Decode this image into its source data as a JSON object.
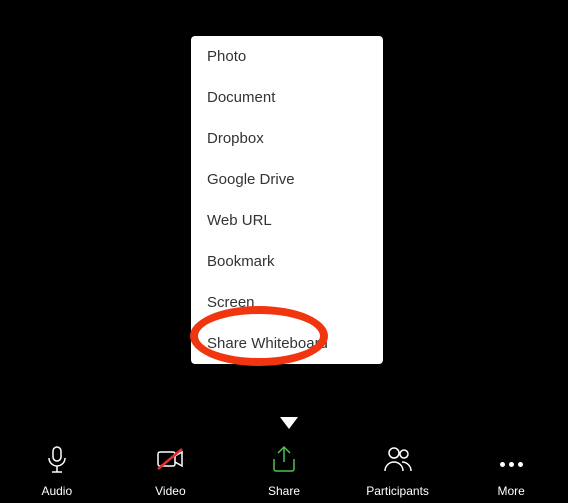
{
  "share_menu": {
    "items": [
      {
        "label": "Photo"
      },
      {
        "label": "Document"
      },
      {
        "label": "Dropbox"
      },
      {
        "label": "Google Drive"
      },
      {
        "label": "Web URL"
      },
      {
        "label": "Bookmark"
      },
      {
        "label": "Screen"
      },
      {
        "label": "Share Whiteboard"
      }
    ]
  },
  "toolbar": {
    "audio": "Audio",
    "video": "Video",
    "share": "Share",
    "participants": "Participants",
    "more": "More"
  }
}
